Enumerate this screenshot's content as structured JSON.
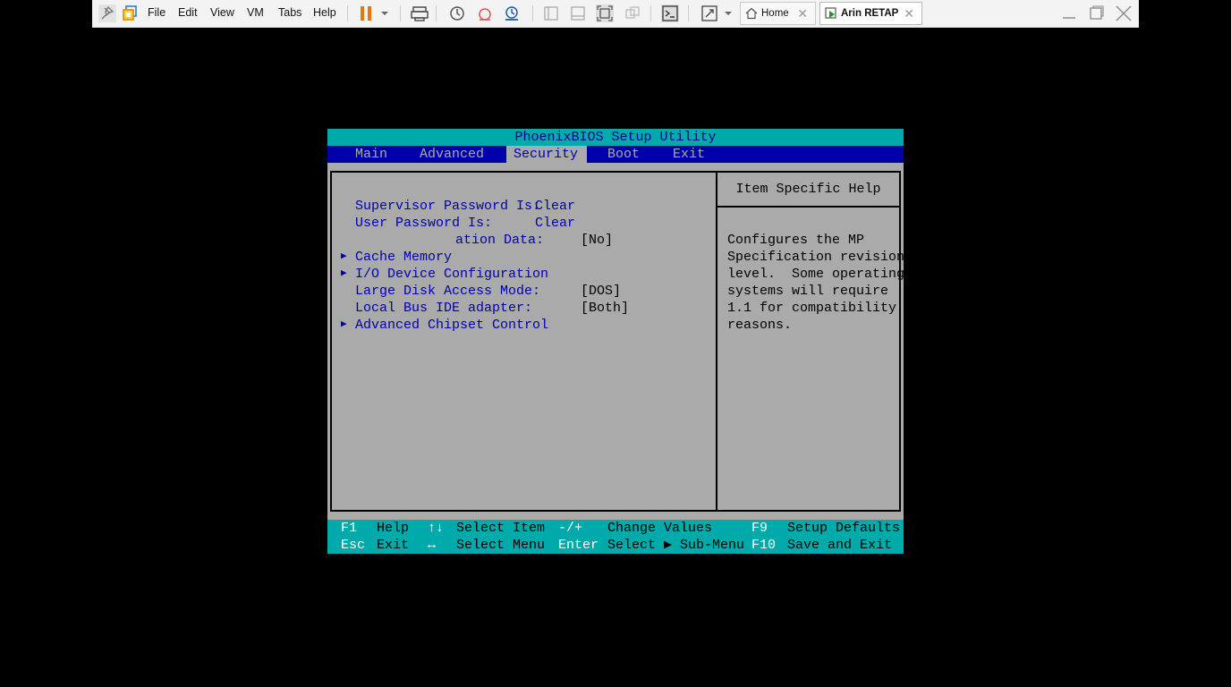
{
  "toolbar": {
    "menus": [
      "File",
      "Edit",
      "View",
      "VM",
      "Tabs",
      "Help"
    ],
    "tabs": [
      {
        "label": "Home",
        "active": false
      },
      {
        "label": "Arin RETAP",
        "active": true
      }
    ],
    "close_glyph": "✕"
  },
  "bios": {
    "title": "PhoenixBIOS Setup Utility",
    "menus": [
      "Main",
      "Advanced",
      "Security",
      "Boot",
      "Exit"
    ],
    "active_menu": "Security",
    "items": [
      {
        "label": "Supervisor Password Is:",
        "value": "Clear",
        "submenu": false
      },
      {
        "label": "User Password Is:",
        "value": "Clear",
        "submenu": false
      },
      {
        "label": "ation Data:",
        "value": "[No]",
        "submenu": false
      },
      {
        "label": "Cache Memory",
        "value": "",
        "submenu": true
      },
      {
        "label": "I/O Device Configuration",
        "value": "",
        "submenu": true
      },
      {
        "label": "Large Disk Access Mode:",
        "value": "[DOS]",
        "submenu": false
      },
      {
        "label": "Local Bus IDE adapter:",
        "value": "[Both]",
        "submenu": false
      },
      {
        "label": "Advanced Chipset Control",
        "value": "",
        "submenu": true
      }
    ],
    "help": {
      "title": "Item Specific Help",
      "lines": [
        "Configures the MP",
        "Specification revision",
        "level.  Some operating",
        "systems will require",
        "1.1 for compatibility",
        "reasons."
      ]
    },
    "footer": [
      {
        "key": "F1",
        "desc": "Help"
      },
      {
        "key": "↑↓",
        "desc": "Select Item"
      },
      {
        "key": "-/+",
        "desc": "Change Values"
      },
      {
        "key": "F9",
        "desc": "Setup Defaults"
      },
      {
        "key": "Esc",
        "desc": "Exit"
      },
      {
        "key": "↔",
        "desc": "Select Menu"
      },
      {
        "key": "Enter",
        "desc": "Select ▶ Sub-Menu"
      },
      {
        "key": "F10",
        "desc": "Save and Exit"
      }
    ],
    "colors": {
      "background": "#aaaaaa",
      "title_bar": "#00aaaa",
      "menu_bar": "#0000aa",
      "text_blue": "#0000aa"
    }
  }
}
